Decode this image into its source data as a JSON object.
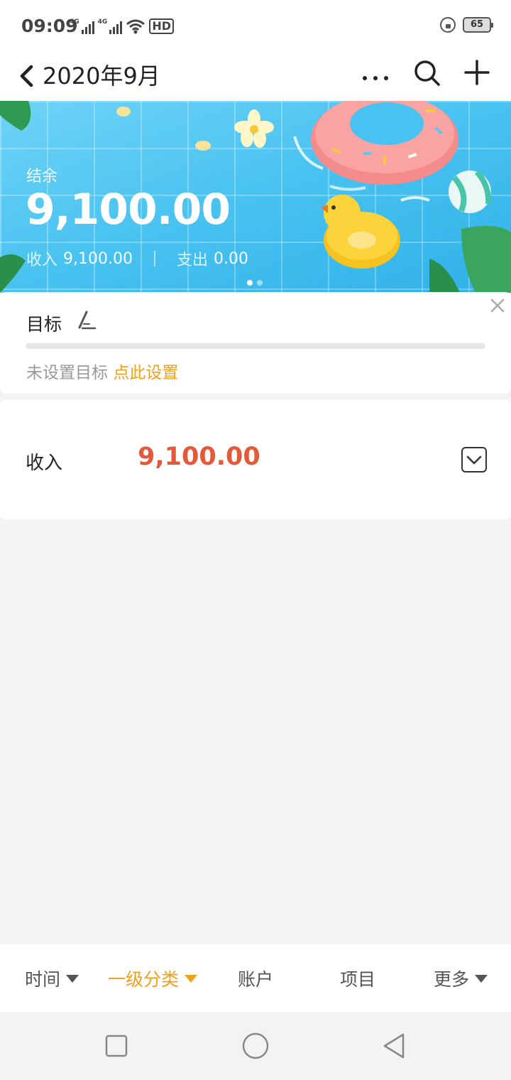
{
  "status_bar": {
    "time": "09:09",
    "network_1": "4G",
    "network_2": "4G",
    "hd_label": "HD",
    "battery": "65"
  },
  "nav": {
    "title": "2020年9月",
    "icons": [
      "chevron-left-icon",
      "more-icon",
      "search-icon",
      "plus-icon"
    ]
  },
  "hero": {
    "balance_label": "结余",
    "balance_value": "9,100.00",
    "income_label": "收入",
    "income_value": "9,100.00",
    "expense_label": "支出",
    "expense_value": "0.00",
    "page_count": 2,
    "active_page": 1
  },
  "goal": {
    "title": "目标",
    "progress": 0,
    "hint": "未设置目标",
    "action": "点此设置"
  },
  "income_card": {
    "label": "收入",
    "value": "9,100.00"
  },
  "filter_bar": {
    "items": [
      {
        "label": "时间",
        "has_caret": true,
        "active": false
      },
      {
        "label": "一级分类",
        "has_caret": true,
        "active": true
      },
      {
        "label": "账户",
        "has_caret": false,
        "active": false
      },
      {
        "label": "项目",
        "has_caret": false,
        "active": false
      },
      {
        "label": "更多",
        "has_caret": true,
        "active": false
      }
    ]
  },
  "colors": {
    "accent": "#f0a11a",
    "income": "#e35a3a",
    "hero_bg": "#48c2f0"
  }
}
